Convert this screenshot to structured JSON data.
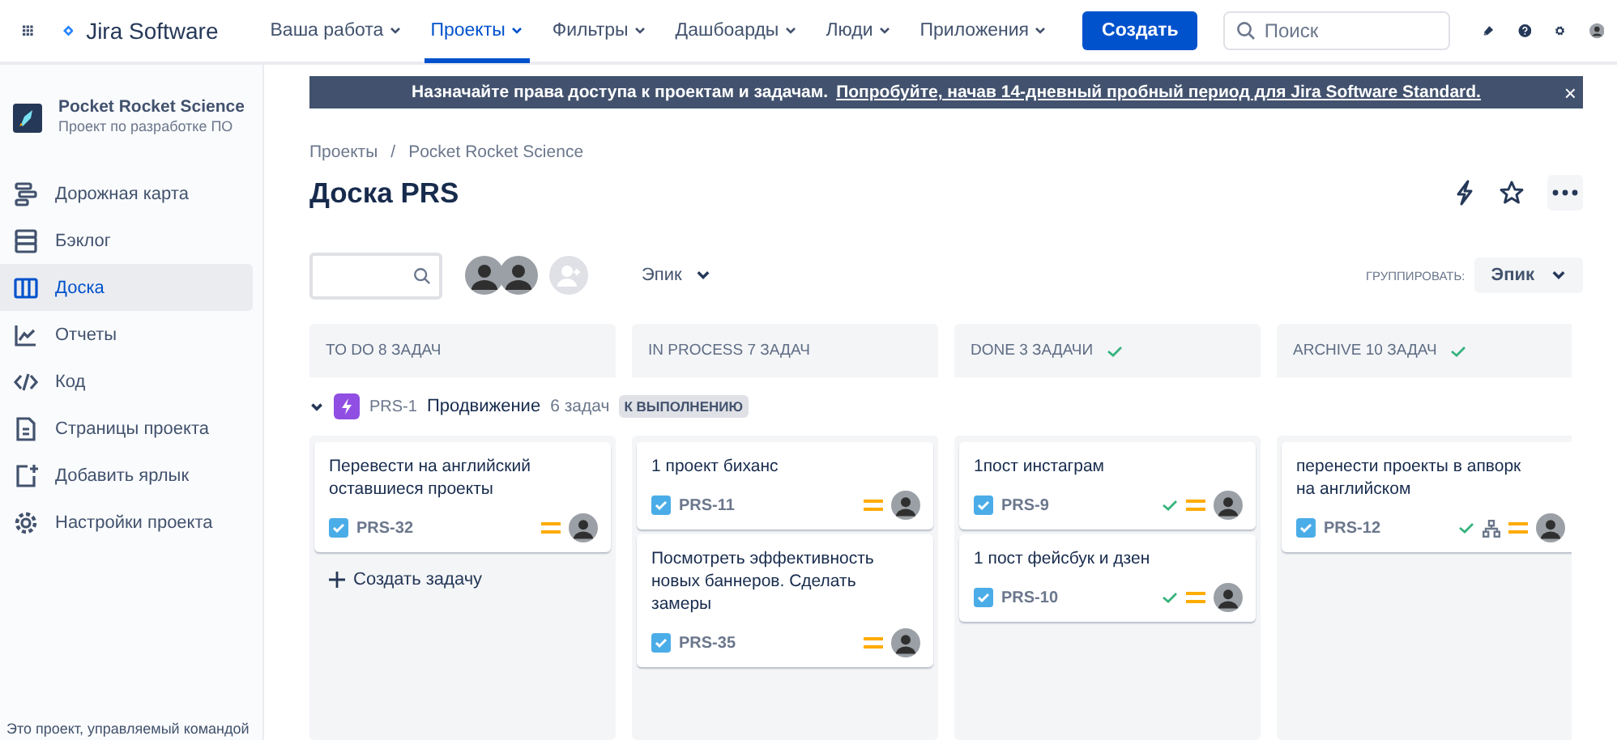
{
  "topnav": {
    "product": "Jira Software",
    "items": [
      {
        "label": "Ваша работа",
        "selected": false
      },
      {
        "label": "Проекты",
        "selected": true
      },
      {
        "label": "Фильтры",
        "selected": false
      },
      {
        "label": "Дашбоарды",
        "selected": false
      },
      {
        "label": "Люди",
        "selected": false
      },
      {
        "label": "Приложения",
        "selected": false
      }
    ],
    "create_button": "Создать",
    "search": {
      "placeholder": "Поиск"
    }
  },
  "sidebar": {
    "project_name": "Pocket Rocket Science",
    "project_type": "Проект по разработке ПО",
    "items": [
      {
        "label": "Дорожная карта",
        "selected": false
      },
      {
        "label": "Бэклог",
        "selected": false
      },
      {
        "label": "Доска",
        "selected": true
      },
      {
        "label": "Отчеты",
        "selected": false
      },
      {
        "label": "Код",
        "selected": false
      },
      {
        "label": "Страницы проекта",
        "selected": false
      },
      {
        "label": "Добавить ярлык",
        "selected": false
      },
      {
        "label": "Настройки проекта",
        "selected": false
      }
    ],
    "footer": "Это проект, управляемый командой"
  },
  "banner": {
    "text": "Назначайте права доступа к проектам и задачам.",
    "link": "Попробуйте, начав 14-дневный пробный период для Jira Software Standard.",
    "close": "×"
  },
  "breadcrumbs": [
    "Проекты",
    "Pocket Rocket Science"
  ],
  "breadcrumb_separator": "/",
  "title": "Доска PRS",
  "toolbar": {
    "epic_filter": "Эпик",
    "group_by_label": "ГРУППИРОВАТЬ:",
    "group_by_value": "Эпик"
  },
  "epic": {
    "expanded": true,
    "key": "PRS-1",
    "name": "Продвижение",
    "count": "6 задач",
    "status": "К ВЫПОЛНЕНИЮ"
  },
  "columns": [
    {
      "title": "TO DO 8 ЗАДАЧ",
      "done": false,
      "create": "Создать задачу",
      "cards": [
        {
          "summary": "Перевести на английский оставшиеся проекты",
          "key": "PRS-32",
          "done": false,
          "has_subtasks": false
        }
      ]
    },
    {
      "title": "IN PROCESS 7 ЗАДАЧ",
      "done": false,
      "cards": [
        {
          "summary": "1 проект биханс",
          "key": "PRS-11",
          "done": false,
          "has_subtasks": false
        },
        {
          "summary": "Посмотреть эффективность новых баннеров. Сделать замеры",
          "key": "PRS-35",
          "done": false,
          "has_subtasks": false
        }
      ]
    },
    {
      "title": "DONE 3 ЗАДАЧИ",
      "done": true,
      "cards": [
        {
          "summary": "1пост инстаграм",
          "key": "PRS-9",
          "done": true,
          "has_subtasks": false
        },
        {
          "summary": "1 пост фейсбук и дзен",
          "key": "PRS-10",
          "done": true,
          "has_subtasks": false
        }
      ]
    },
    {
      "title": "ARCHIVE 10 ЗАДАЧ",
      "done": true,
      "cards": [
        {
          "summary": "перенести проекты в апворк на английском",
          "key": "PRS-12",
          "done": true,
          "has_subtasks": true
        }
      ]
    }
  ]
}
